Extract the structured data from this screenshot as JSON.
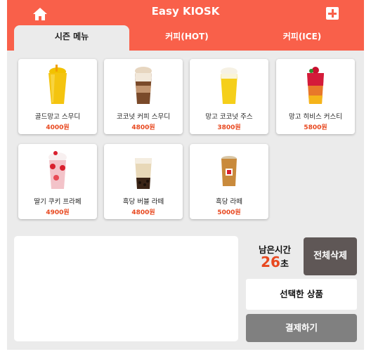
{
  "header": {
    "title": "Easy KIOSK"
  },
  "tabs": [
    {
      "label": "시즌 메뉴"
    },
    {
      "label": "커피(HOT)"
    },
    {
      "label": "커피(ICE)"
    }
  ],
  "menu": [
    {
      "name": "골드망고 스무디",
      "price": "4000원",
      "icon": "mango-smoothie-image"
    },
    {
      "name": "코코넛 커피 스무디",
      "price": "4800원",
      "icon": "coconut-coffee-smoothie-image"
    },
    {
      "name": "망고 코코넛 주스",
      "price": "3800원",
      "icon": "mango-coconut-juice-image"
    },
    {
      "name": "망고 히비스 커스티",
      "price": "5800원",
      "icon": "mango-hibiscus-tea-image"
    },
    {
      "name": "딸기 쿠키 프라페",
      "price": "4900원",
      "icon": "strawberry-cookie-frappe-image"
    },
    {
      "name": "흑당 버블 라떼",
      "price": "4800원",
      "icon": "brown-sugar-bubble-latte-image"
    },
    {
      "name": "흑당 라떼",
      "price": "5000원",
      "icon": "brown-sugar-latte-image"
    }
  ],
  "timer": {
    "label": "남은시간",
    "seconds": "26",
    "unit": "초"
  },
  "buttons": {
    "clear_all": "전체삭제",
    "selected_items": "선택한 상품",
    "checkout": "결제하기"
  },
  "colors": {
    "accent": "#f9604a",
    "price": "#e8481f",
    "clear_button": "#5f5756",
    "checkout_button": "#808080"
  }
}
